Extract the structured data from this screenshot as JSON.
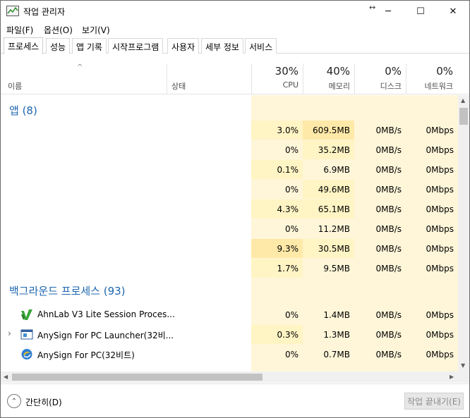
{
  "window": {
    "title": "작업 관리자",
    "minimize_glyph": "─",
    "maximize_glyph": "☐",
    "close_glyph": "✕",
    "resize_glyph": "↔"
  },
  "menu": [
    "파일(F)",
    "옵션(O)",
    "보기(V)"
  ],
  "tabs": [
    "프로세스",
    "성능",
    "앱 기록",
    "시작프로그램",
    "사용자",
    "세부 정보",
    "서비스"
  ],
  "columns": {
    "sort_caret": "^",
    "name": "이름",
    "status": "상태",
    "cpu": {
      "percent": "30%",
      "label": "CPU"
    },
    "memory": {
      "percent": "40%",
      "label": "메모리"
    },
    "disk": {
      "percent": "0%",
      "label": "디스크"
    },
    "network": {
      "percent": "0%",
      "label": "네트워크"
    }
  },
  "groups": {
    "apps": {
      "label": "앱 (8)"
    },
    "background": {
      "label": "백그라운드 프로세스 (93)"
    }
  },
  "app_rows": [
    {
      "cpu": "3.0%",
      "memory": "609.5MB",
      "disk": "0MB/s",
      "network": "0Mbps"
    },
    {
      "cpu": "0%",
      "memory": "35.2MB",
      "disk": "0MB/s",
      "network": "0Mbps"
    },
    {
      "cpu": "0.1%",
      "memory": "6.9MB",
      "disk": "0MB/s",
      "network": "0Mbps"
    },
    {
      "cpu": "0%",
      "memory": "49.6MB",
      "disk": "0MB/s",
      "network": "0Mbps"
    },
    {
      "cpu": "4.3%",
      "memory": "65.1MB",
      "disk": "0MB/s",
      "network": "0Mbps"
    },
    {
      "cpu": "0%",
      "memory": "11.2MB",
      "disk": "0MB/s",
      "network": "0Mbps"
    },
    {
      "cpu": "9.3%",
      "memory": "30.5MB",
      "disk": "0MB/s",
      "network": "0Mbps"
    },
    {
      "cpu": "1.7%",
      "memory": "9.5MB",
      "disk": "0MB/s",
      "network": "0Mbps"
    }
  ],
  "background_rows": [
    {
      "name": "AhnLab V3 Lite Session Proces...",
      "icon": "ahnlab-icon",
      "expandable": false,
      "cpu": "0%",
      "memory": "1.4MB",
      "disk": "0MB/s",
      "network": "0Mbps"
    },
    {
      "name": "AnySign For PC Launcher(32비...",
      "icon": "anysign-launcher-icon",
      "expandable": true,
      "expand_glyph": "›",
      "cpu": "0.3%",
      "memory": "1.3MB",
      "disk": "0MB/s",
      "network": "0Mbps"
    },
    {
      "name": "AnySign For PC(32비트)",
      "icon": "anysign-icon",
      "expandable": false,
      "cpu": "0%",
      "memory": "0.7MB",
      "disk": "0MB/s",
      "network": "0Mbps"
    }
  ],
  "footer": {
    "fewer_details": "간단히(D)",
    "fewer_glyph": "⌃",
    "end_task": "작업 끝내기(E)"
  },
  "colors": {
    "cpu_highlight_strong": "#ffe9a8",
    "heat_light": "#fff4c4",
    "heat_bg": "#fff6d9",
    "group_blue": "#1e66b0"
  }
}
